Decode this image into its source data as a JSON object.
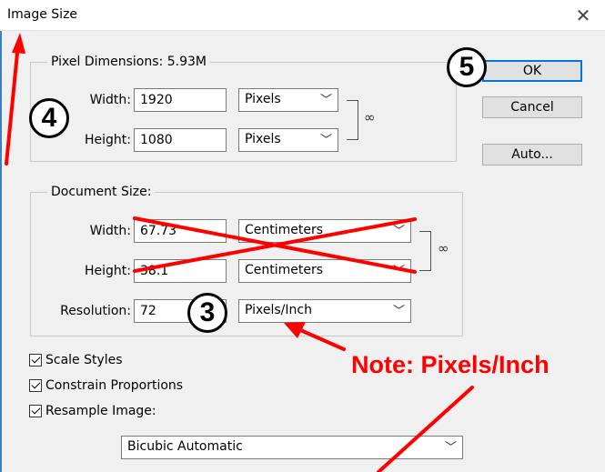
{
  "window": {
    "title": "Image Size",
    "close_glyph": "✕"
  },
  "pixel_dimensions": {
    "legend": "Pixel Dimensions:  5.93M",
    "width_label": "Width:",
    "width_value": "1920",
    "width_unit": "Pixels",
    "height_label": "Height:",
    "height_value": "1080",
    "height_unit": "Pixels"
  },
  "document_size": {
    "legend": "Document Size:",
    "width_label": "Width:",
    "width_value": "67.73",
    "width_unit": "Centimeters",
    "height_label": "Height:",
    "height_value": "38.1",
    "height_unit": "Centimeters",
    "resolution_label": "Resolution:",
    "resolution_value": "72",
    "resolution_unit": "Pixels/Inch"
  },
  "buttons": {
    "ok": "OK",
    "cancel": "Cancel",
    "auto": "Auto..."
  },
  "options": {
    "scale_styles": "Scale Styles",
    "constrain_proportions": "Constrain Proportions",
    "resample_image": "Resample Image:",
    "resample_method": "Bicubic Automatic"
  },
  "annotations": {
    "step_3": "3",
    "step_4": "4",
    "step_5": "5",
    "note": "Note: Pixels/Inch",
    "color": "#ff0000"
  },
  "icons": {
    "chevron": "chevron-down-icon",
    "link": "chain-link-icon",
    "close": "close-icon"
  }
}
